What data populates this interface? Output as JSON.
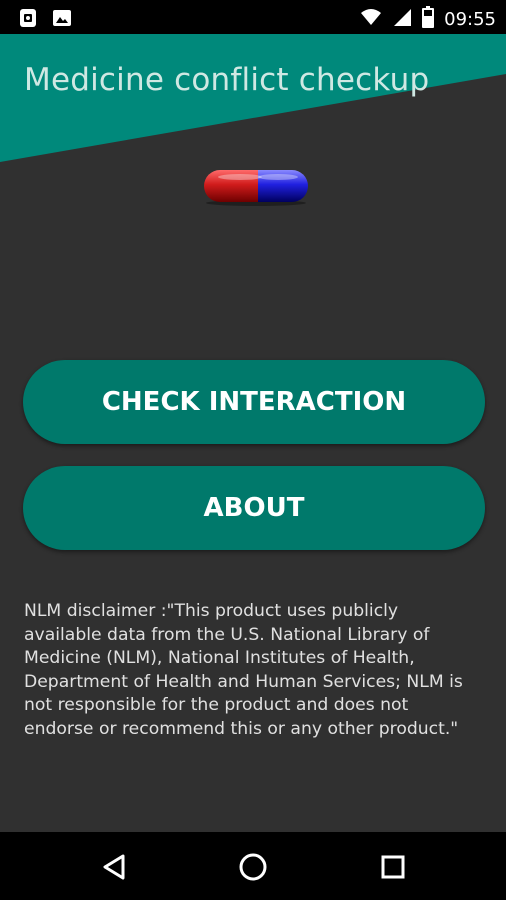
{
  "status_bar": {
    "time": "09:55",
    "icons": [
      "sim-card-icon",
      "image-icon",
      "wifi-icon",
      "signal-icon",
      "battery-icon"
    ]
  },
  "app": {
    "title": "Medicine conflict checkup",
    "accent_color": "#00796b",
    "header_color": "#00897b",
    "background_color": "#303030"
  },
  "actions": {
    "check_interaction_label": "CHECK INTERACTION",
    "about_label": "ABOUT"
  },
  "disclaimer": {
    "text": "NLM disclaimer :\"This product uses publicly available data from the U.S. National Library of Medicine (NLM), National Institutes of Health, Department of Health and Human Services; NLM is not responsible for the product and does not endorse or recommend this or any other product.\""
  },
  "nav": {
    "icons": [
      "back-icon",
      "home-icon",
      "recents-icon"
    ]
  }
}
